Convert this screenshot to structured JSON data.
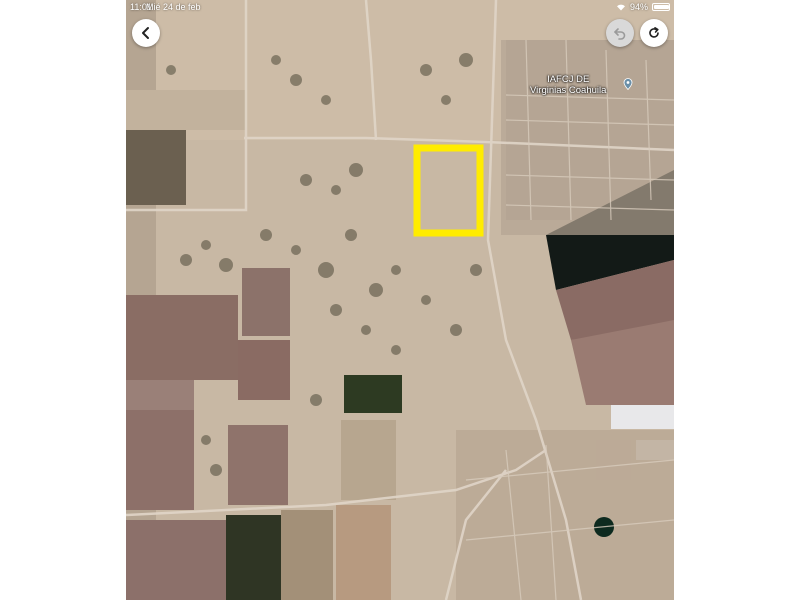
{
  "status_bar": {
    "time": "11:01",
    "date": "Mié 24 de feb",
    "battery": "94%",
    "battery_level": 0.94
  },
  "toolbar": {
    "back_icon": "chevron-left-icon",
    "undo_icon": "undo-icon",
    "redo_icon": "refresh-icon"
  },
  "map": {
    "poi_label_line1": "IAFCJ DE",
    "poi_label_line2": "Virginias Coahuila",
    "poi_icon": "place-pin-icon",
    "highlight_color": "#ffec00"
  }
}
